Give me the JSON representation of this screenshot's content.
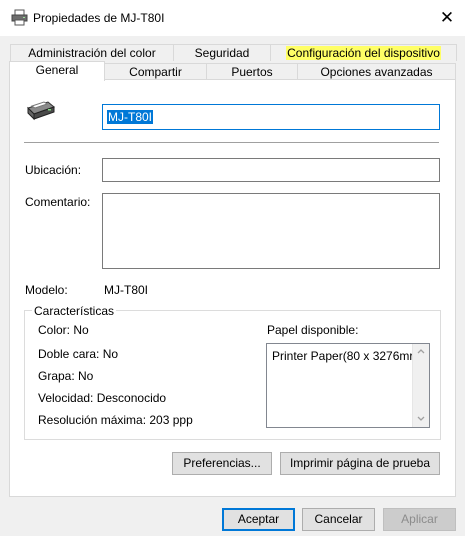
{
  "window": {
    "title": "Propiedades de MJ-T80I",
    "close_glyph": "✕"
  },
  "tabs_row1": [
    {
      "label": "Administración del color",
      "highlighted": false
    },
    {
      "label": "Seguridad",
      "highlighted": false
    },
    {
      "label": "Configuración del dispositivo",
      "highlighted": true
    }
  ],
  "tabs_row2": [
    {
      "label": "General",
      "active": true
    },
    {
      "label": "Compartir",
      "active": false
    },
    {
      "label": "Puertos",
      "active": false
    },
    {
      "label": "Opciones avanzadas",
      "active": false
    }
  ],
  "general": {
    "printer_icon": "printer-icon",
    "printer_name": "MJ-T80I",
    "location_label": "Ubicación:",
    "location_value": "",
    "comment_label": "Comentario:",
    "comment_value": "",
    "model_label": "Modelo:",
    "model_value": "MJ-T80I"
  },
  "features": {
    "legend": "Características",
    "color": "Color: No",
    "duplex": "Doble cara: No",
    "staple": "Grapa: No",
    "speed": "Velocidad: Desconocido",
    "resolution": "Resolución máxima: 203 ppp",
    "paper_label": "Papel disponible:",
    "paper_items": [
      "Printer Paper(80 x 3276mr"
    ]
  },
  "buttons": {
    "preferences": "Preferencias...",
    "print_test": "Imprimir página de prueba",
    "accept": "Aceptar",
    "cancel": "Cancelar",
    "apply": "Aplicar"
  },
  "colors": {
    "accent": "#0078d7",
    "highlight": "#ffff66"
  }
}
